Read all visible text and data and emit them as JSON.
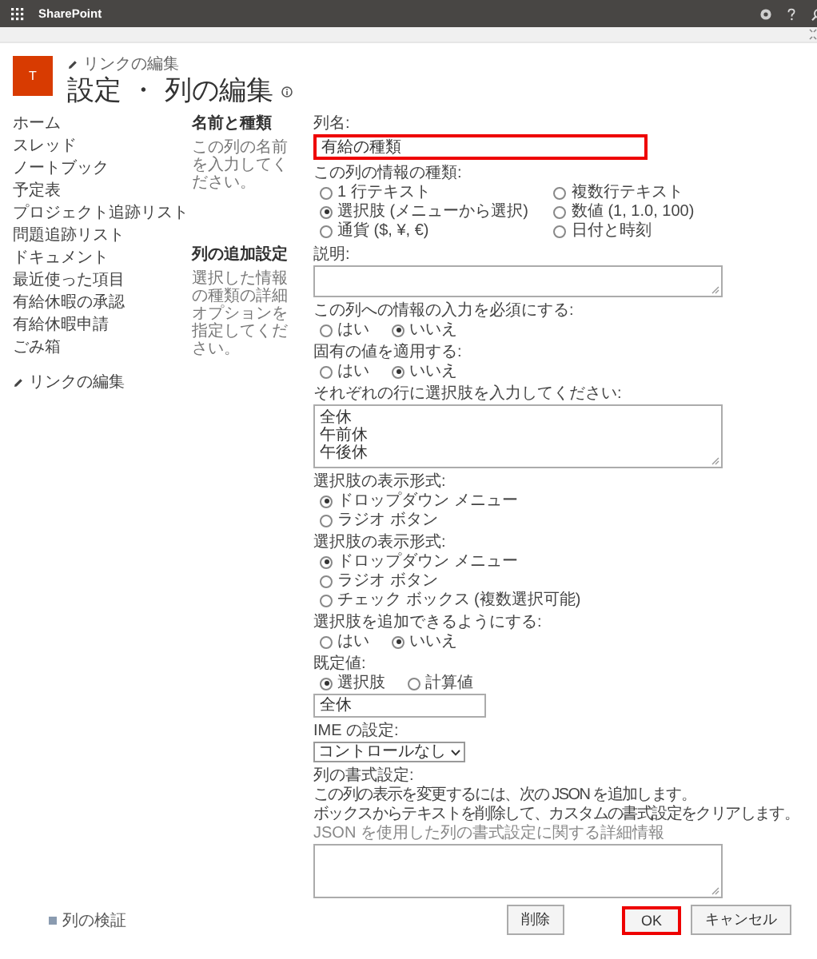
{
  "app_bar": {
    "title": "SharePoint"
  },
  "header": {
    "logo": "T",
    "edit_link": "リンクの編集",
    "title": "設定",
    "separator": "・",
    "page": "列の編集"
  },
  "nav": {
    "items": [
      "ホーム",
      "スレッド",
      "ノートブック",
      "予定表",
      "プロジェクト追跡リスト",
      "問題追跡リスト",
      "ドキュメント",
      "最近使った項目",
      "有給休暇の承認",
      "有給休暇申請",
      "ごみ箱"
    ],
    "edit_link": "リンクの編集"
  },
  "sections": [
    {
      "title": "名前と種類",
      "description": "この列の名前を入力してください。",
      "fields": [
        {
          "kind": "text",
          "label": "列名:",
          "value": "有給の種類",
          "highlighted": true
        },
        {
          "kind": "radio_grid",
          "label": "この列の情報の種類:",
          "options": [
            {
              "label": "1 行テキスト",
              "selected": false
            },
            {
              "label": "複数行テキスト",
              "selected": false
            },
            {
              "label": "選択肢 (メニューから選択)",
              "selected": true
            },
            {
              "label": "数値 (1, 1.0, 100)",
              "selected": false
            },
            {
              "label": "通貨 ($, ¥, €)",
              "selected": false
            },
            {
              "label": "日付と時刻",
              "selected": false
            }
          ]
        }
      ]
    },
    {
      "title": "列の追加設定",
      "description": "選択した情報の種類の詳細オプションを指定してください。",
      "fields": [
        {
          "kind": "textarea",
          "label": "説明:"
        },
        {
          "kind": "radio_row",
          "label": "この列への情報の入力を必須にする:",
          "options": [
            {
              "label": "はい",
              "selected": false
            },
            {
              "label": "いいえ",
              "selected": true
            }
          ]
        },
        {
          "kind": "radio_row",
          "label": "固有の値を適用する:",
          "options": [
            {
              "label": "はい",
              "selected": false
            },
            {
              "label": "いいえ",
              "selected": true
            }
          ]
        },
        {
          "kind": "textarea",
          "label": "それぞれの行に選択肢を入力してください:",
          "lines": [
            "全休",
            "午前休",
            "午後休"
          ]
        },
        {
          "kind": "radio_list",
          "label": "選択肢の表示形式:",
          "options": [
            {
              "label": "ドロップダウン メニュー",
              "selected": true
            },
            {
              "label": "ラジオ ボタン",
              "selected": false
            }
          ]
        },
        {
          "kind": "radio_list",
          "label": "選択肢の表示形式:",
          "options": [
            {
              "label": "ドロップダウン メニュー",
              "selected": true
            },
            {
              "label": "ラジオ ボタン",
              "selected": false
            },
            {
              "label": "チェック ボックス (複数選択可能)",
              "selected": false
            }
          ]
        },
        {
          "kind": "radio_row",
          "label": "選択肢を追加できるようにする:",
          "options": [
            {
              "label": "はい",
              "selected": false
            },
            {
              "label": "いいえ",
              "selected": true
            }
          ]
        },
        {
          "kind": "default_value",
          "label": "既定値:",
          "options": [
            {
              "label": "選択肢",
              "selected": true
            },
            {
              "label": "計算値",
              "selected": false
            }
          ],
          "value": "全休"
        },
        {
          "kind": "dropdown",
          "label": "IME の設定:",
          "value": "コントロールなし"
        },
        {
          "kind": "formatting",
          "label": "列の書式設定:",
          "lines": [
            "この列の表示を変更するには、次の JSON を追加します。",
            "ボックスからテキストを削除して、カスタムの書式設定をクリアします。"
          ],
          "link": "JSON を使用した列の書式設定に関する詳細情報"
        }
      ]
    }
  ],
  "footer": {
    "validation": "列の検証",
    "buttons": [
      {
        "label": "削除",
        "highlighted": false
      },
      {
        "label": "OK",
        "highlighted": true
      },
      {
        "label": "キャンセル",
        "highlighted": false
      }
    ]
  }
}
